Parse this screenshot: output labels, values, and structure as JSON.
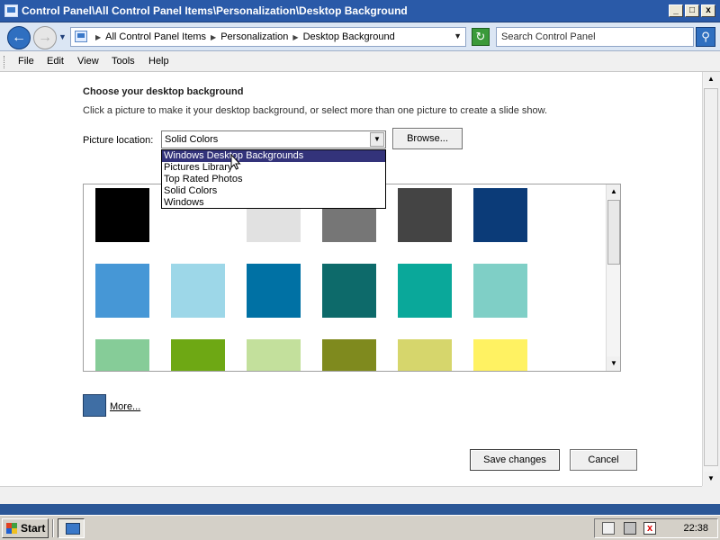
{
  "window": {
    "title": "Control Panel\\All Control Panel Items\\Personalization\\Desktop Background",
    "minimize": "_",
    "maximize": "□",
    "close": "x"
  },
  "address": {
    "crumbs": [
      "All Control Panel Items",
      "Personalization",
      "Desktop Background"
    ],
    "search_placeholder": "Search Control Panel"
  },
  "menu": [
    "File",
    "Edit",
    "View",
    "Tools",
    "Help"
  ],
  "page": {
    "heading": "Choose your desktop background",
    "instructions": "Click a picture to make it your desktop background, or select more than one picture to create a slide show.",
    "location_label": "Picture location:",
    "location_value": "Solid Colors",
    "browse_label": "Browse...",
    "more_label": "More...",
    "save_label": "Save changes",
    "cancel_label": "Cancel"
  },
  "dropdown": {
    "options": [
      "Windows Desktop Backgrounds",
      "Pictures Library",
      "Top Rated Photos",
      "Solid Colors",
      "Windows"
    ],
    "highlighted_index": 0
  },
  "swatches": {
    "row1": [
      "#000000",
      "#ffffff",
      "#e1e1e1",
      "#767676",
      "#444444",
      "#0b3b78"
    ],
    "row2": [
      "#4697d6",
      "#9dd7e8",
      "#0071a4",
      "#0d6a6a",
      "#0aa89a",
      "#7fcfc6"
    ],
    "row3": [
      "#86cc98",
      "#6ea814",
      "#c3e09c",
      "#7f8a1e",
      "#d6d66c",
      "#fff262"
    ],
    "more_color": "#3f6ea4"
  },
  "taskbar": {
    "start_label": "Start",
    "clock": "22:38"
  }
}
